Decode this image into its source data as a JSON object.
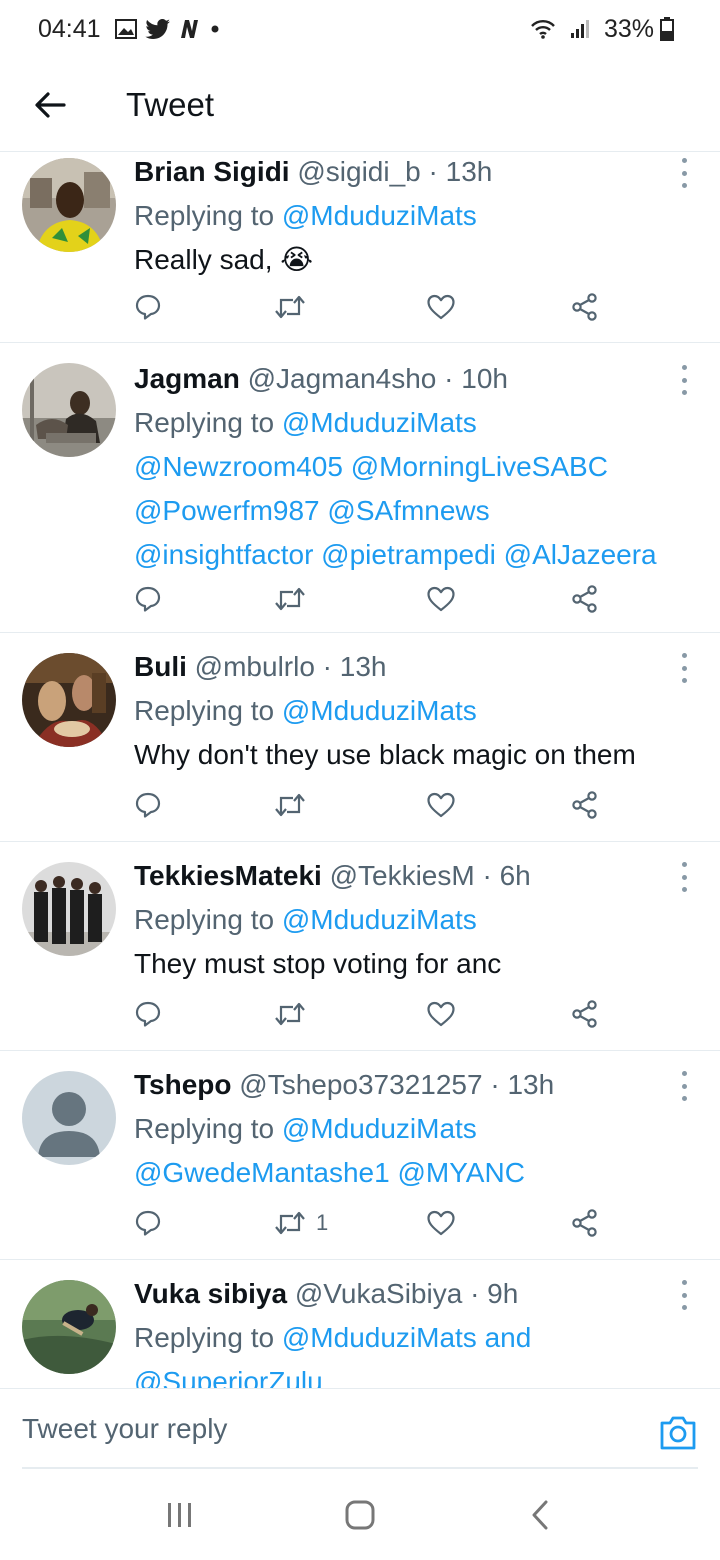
{
  "status_bar": {
    "time": "04:41",
    "battery": "33%"
  },
  "header": {
    "title": "Tweet"
  },
  "tweets": [
    {
      "name": "Brian Sigidi",
      "meta": "@sigidi_b · 13h",
      "replying_prefix": "Replying to",
      "replying_to": "@MduduziMats",
      "text": "Really sad,",
      "emoji": "😭",
      "retweets": ""
    },
    {
      "name": "Jagman",
      "meta": "@Jagman4sho · 10h",
      "replying_prefix": "Replying to",
      "replying_to": "@MduduziMats",
      "mentions": [
        "@Newzroom405 @MorningLiveSABC",
        "@Powerfm987 @SAfmnews",
        "@insightfactor @pietrampedi @AlJazeera"
      ],
      "retweets": ""
    },
    {
      "name": "Buli",
      "meta": "@mbulrlo · 13h",
      "replying_prefix": "Replying to",
      "replying_to": "@MduduziMats",
      "text": "Why don't they use black magic on them",
      "retweets": ""
    },
    {
      "name": "TekkiesMateki",
      "meta": "@TekkiesM · 6h",
      "replying_prefix": "Replying to",
      "replying_to": "@MduduziMats",
      "text": "They must stop voting for anc",
      "retweets": ""
    },
    {
      "name": "Tshepo",
      "meta": "@Tshepo37321257 · 13h",
      "replying_prefix": "Replying to",
      "replying_to": "@MduduziMats",
      "mentions": [
        "@GwedeMantashe1 @MYANC"
      ],
      "retweets": "1"
    },
    {
      "name": "Vuka sibiya",
      "meta": "@VukaSibiya · 9h",
      "replying_prefix": "Replying to",
      "replying_to": "@MduduziMats and",
      "mentions": [
        "@SuperiorZulu"
      ],
      "retweets": ""
    }
  ],
  "reply": {
    "placeholder": "Tweet your reply"
  },
  "icons": {
    "back": "arrow-left-icon",
    "more": "more-vertical-icon",
    "reply": "comment-icon",
    "retweet": "retweet-icon",
    "like": "heart-icon",
    "share": "share-icon",
    "camera": "camera-icon"
  },
  "colors": {
    "link": "#1d9bf0",
    "text": "#0f1419",
    "muted": "#536471"
  }
}
